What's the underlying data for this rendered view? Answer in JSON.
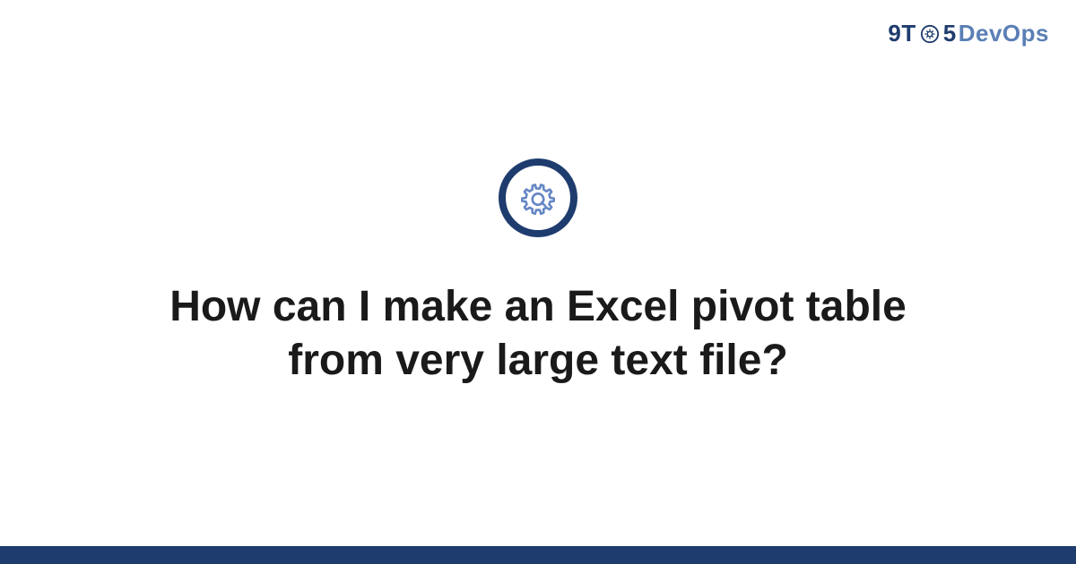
{
  "logo": {
    "part1": "9T",
    "part2": "5",
    "part3": "DevOps"
  },
  "title": "How can I make an Excel pivot table from very large text file?",
  "colors": {
    "primary": "#1e3c6e",
    "secondary": "#5a7fb5",
    "iconStroke": "#6687c4"
  }
}
